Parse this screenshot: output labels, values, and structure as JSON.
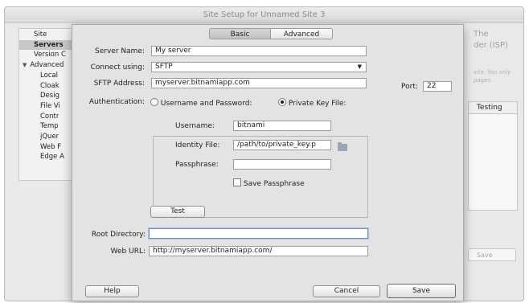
{
  "background_window": {
    "title": "Site Setup for Unnamed Site 3",
    "sidebar_items": [
      {
        "label": "Site",
        "selected": false,
        "expander": false
      },
      {
        "label": "Servers",
        "selected": true,
        "expander": false
      },
      {
        "label": "Version C",
        "selected": false,
        "expander": false
      },
      {
        "label": "Advanced",
        "selected": false,
        "expander": true
      },
      {
        "label": "Local",
        "selected": false,
        "expander": false
      },
      {
        "label": "Cloak",
        "selected": false,
        "expander": false
      },
      {
        "label": "Desig",
        "selected": false,
        "expander": false
      },
      {
        "label": "File Vi",
        "selected": false,
        "expander": false
      },
      {
        "label": "Contr",
        "selected": false,
        "expander": false
      },
      {
        "label": "Temp",
        "selected": false,
        "expander": false
      },
      {
        "label": "jQuer",
        "selected": false,
        "expander": false
      },
      {
        "label": "Web F",
        "selected": false,
        "expander": false
      },
      {
        "label": "Edge A",
        "selected": false,
        "expander": false
      }
    ],
    "right_heading_line1": "The",
    "right_heading_line2": "der (ISP)",
    "right_hint_line1": "site. You only",
    "right_hint_line2": "pages.",
    "table_header": "Testing",
    "save_button": "Save"
  },
  "dialog": {
    "tabs": {
      "basic": "Basic",
      "advanced": "Advanced",
      "active": "basic"
    },
    "server_name_label": "Server Name:",
    "server_name_value": "My server",
    "connect_using_label": "Connect using:",
    "connect_using_value": "SFTP",
    "sftp_address_label": "SFTP Address:",
    "sftp_address_value": "myserver.bitnamiapp.com",
    "port_label": "Port:",
    "port_value": "22",
    "authentication_label": "Authentication:",
    "auth_option_password": "Username and Password:",
    "auth_option_key": "Private Key File:",
    "auth_selected": "key",
    "username_label": "Username:",
    "username_value": "bitnami",
    "identity_file_label": "Identity File:",
    "identity_file_value": "/path/to/private_key.p",
    "passphrase_label": "Passphrase:",
    "passphrase_value": "",
    "save_passphrase_label": "Save Passphrase",
    "save_passphrase_checked": false,
    "test_button": "Test",
    "root_directory_label": "Root Directory:",
    "root_directory_value": "",
    "web_url_label": "Web URL:",
    "web_url_value": "http://myserver.bitnamiapp.com/",
    "help_button": "Help",
    "cancel_button": "Cancel",
    "save_button": "Save"
  }
}
